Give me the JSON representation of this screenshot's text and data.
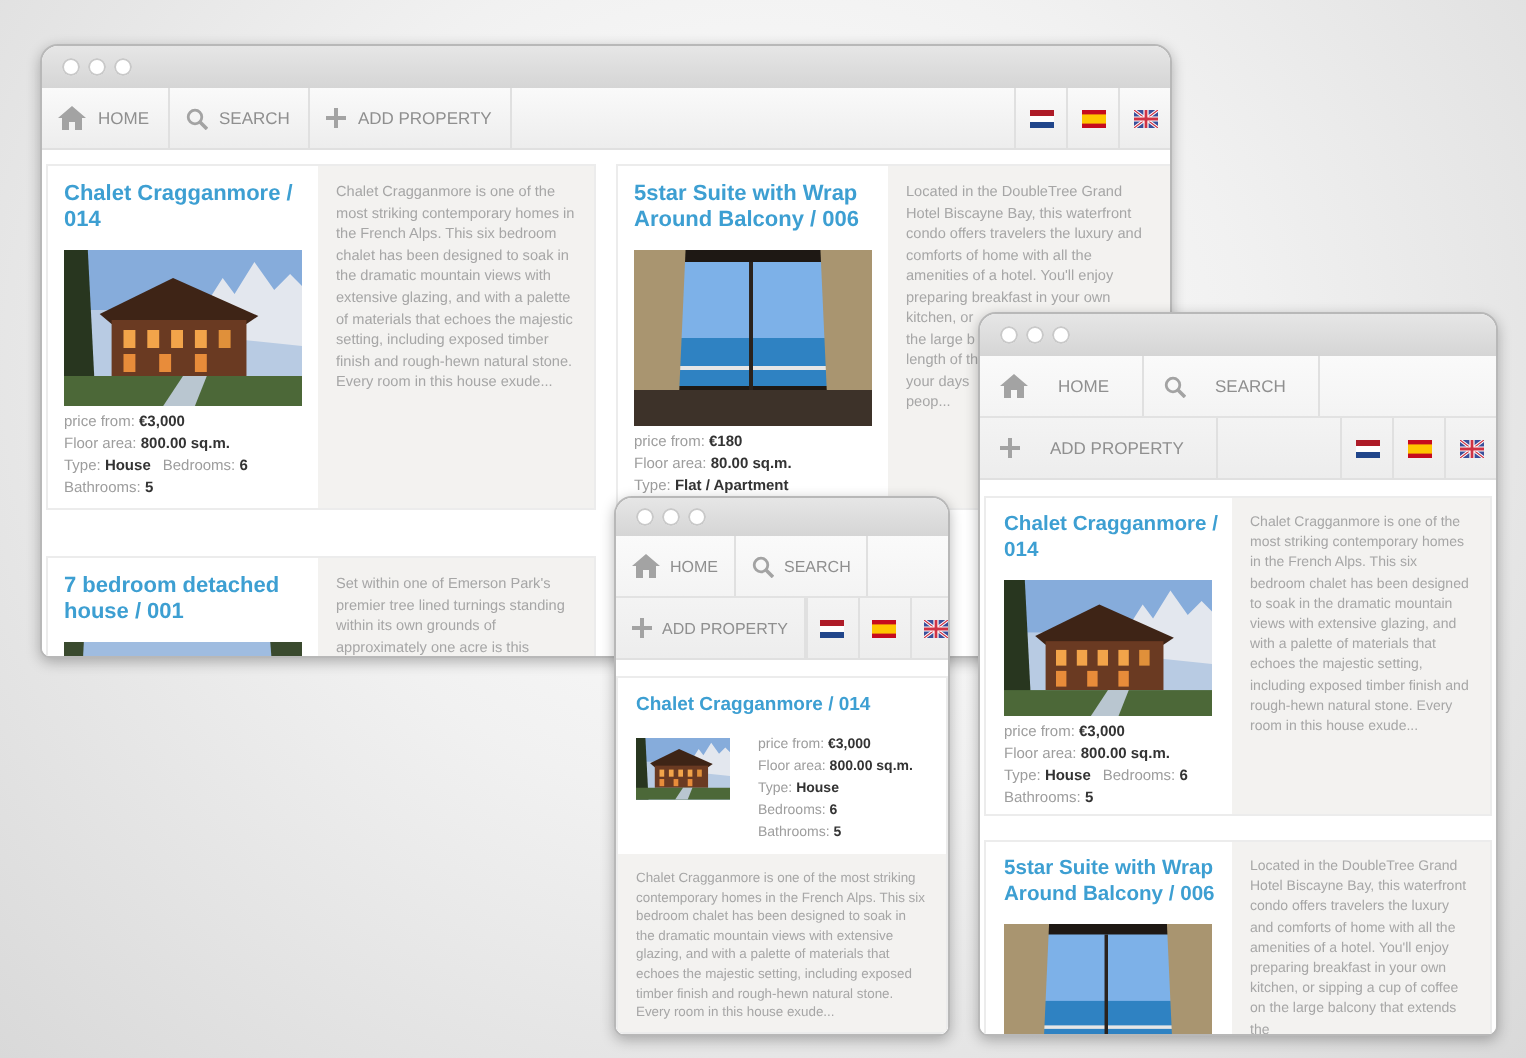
{
  "windows": [
    {
      "kind": "wide",
      "nav": {
        "rows": [
          {
            "links": [
              {
                "kind": "home",
                "label": "HOME"
              },
              {
                "kind": "search",
                "label": "SEARCH"
              },
              {
                "kind": "add",
                "label": "ADD PROPERTY"
              }
            ],
            "flags": [
              {
                "kind": "nl"
              },
              {
                "kind": "es"
              },
              {
                "kind": "gb"
              }
            ]
          }
        ]
      },
      "listings": [
        {
          "title": "Chalet Cragganmore / 014",
          "photo": {
            "kind": "chalet"
          },
          "details": [
            [
              "price from: **€3,000**"
            ],
            [
              "Floor area: **800.00 sq.m.**"
            ],
            [
              "Type: **House**",
              "Bedrooms: **6**"
            ],
            [
              "Bathrooms: **5**"
            ]
          ],
          "description": "Chalet Cragganmore is one of the most striking contemporary homes in the French Alps. This six bedroom chalet has been designed to soak in the dramatic mountain views with extensive glazing, and with a palette of materials that echoes the majestic setting, including exposed timber finish and rough-hewn natural stone. Every room in this house exude..."
        },
        {
          "title": "5star Suite with Wrap Around Balcony / 006",
          "photo": {
            "kind": "sea-view"
          },
          "details": [
            [
              "price from: **€180**"
            ],
            [
              "Floor area: **80.00 sq.m.**"
            ],
            [
              "Type: **Flat / Apartment**"
            ]
          ],
          "description_lines": [
            "Located in the DoubleTree Grand",
            "Hotel Biscayne Bay, this waterfront",
            "condo offers travelers the luxury and",
            "comforts of home with all the",
            "amenities of a hotel. You'll enjoy",
            "preparing breakfast in your own",
            "kitchen, or",
            "the large b",
            "length of th",
            "your days",
            "peop..."
          ]
        },
        {
          "title": "7 bedroom detached house / 001",
          "photo": {
            "kind": "outdoor"
          },
          "description": "Set within one of Emerson Park's premier tree lined turnings standing within its own grounds of approximately one acre is this"
        }
      ]
    },
    {
      "kind": "phone",
      "nav": {
        "rows": [
          {
            "links": [
              {
                "kind": "home",
                "label": "HOME"
              },
              {
                "kind": "search",
                "label": "SEARCH"
              }
            ]
          },
          {
            "links": [
              {
                "kind": "add",
                "label": "ADD PROPERTY"
              }
            ],
            "flags": [
              {
                "kind": "nl"
              },
              {
                "kind": "es"
              },
              {
                "kind": "gb"
              }
            ]
          }
        ]
      },
      "listings": [
        {
          "title": "Chalet Cragganmore / 014",
          "photo": {
            "kind": "chalet"
          },
          "details": [
            [
              "price from: **€3,000**"
            ],
            [
              "Floor area: **800.00 sq.m.**"
            ],
            [
              "Type: **House**"
            ],
            [
              "Bedrooms: **6**"
            ],
            [
              "Bathrooms: **5**"
            ]
          ],
          "description": "Chalet Cragganmore is one of the most striking contemporary homes in the French Alps. This six bedroom chalet has been designed to soak in the dramatic mountain views with extensive glazing, and with a palette of materials that echoes the majestic setting, including exposed timber finish and rough-hewn natural stone. Every room in this house exude..."
        }
      ]
    },
    {
      "kind": "tablet",
      "nav": {
        "rows": [
          {
            "links": [
              {
                "kind": "home",
                "label": "HOME"
              },
              {
                "kind": "search",
                "label": "SEARCH"
              }
            ]
          },
          {
            "links": [
              {
                "kind": "add",
                "label": "ADD PROPERTY"
              }
            ],
            "flags": [
              {
                "kind": "nl"
              },
              {
                "kind": "es"
              },
              {
                "kind": "gb"
              }
            ]
          }
        ]
      },
      "listings": [
        {
          "title": "Chalet Cragganmore / 014",
          "photo": {
            "kind": "chalet"
          },
          "details": [
            [
              "price from: **€3,000**"
            ],
            [
              "Floor area: **800.00 sq.m.**"
            ],
            [
              "Type: **House**",
              "Bedrooms: **6**"
            ],
            [
              "Bathrooms: **5**"
            ]
          ],
          "description": "Chalet Cragganmore is one of the most striking contemporary homes in the French Alps. This six bedroom chalet has been designed to soak in the dramatic mountain views with extensive glazing, and with a palette of materials that echoes the majestic setting, including exposed timber finish and rough-hewn natural stone. Every room in this house exude..."
        },
        {
          "title": "5star Suite with Wrap Around Balcony / 006",
          "photo": {
            "kind": "sea-view"
          },
          "description": "Located in the DoubleTree Grand Hotel Biscayne Bay, this waterfront condo offers travelers the luxury and comforts of home with all the amenities of a hotel. You'll enjoy preparing breakfast in your own kitchen, or sipping a cup of coffee on the large balcony that extends the"
        }
      ]
    }
  ]
}
